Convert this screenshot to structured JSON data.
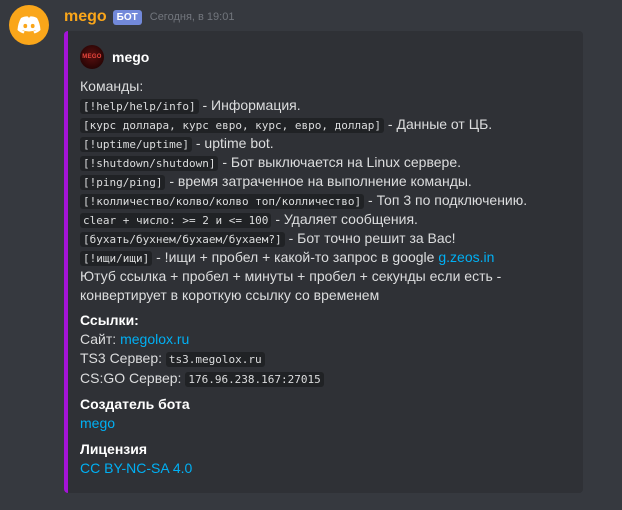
{
  "message": {
    "author": "mego",
    "bot_tag": "БОТ",
    "timestamp": "Сегодня, в 19:01",
    "avatar_icon": "discord-logo-icon",
    "avatar_color": "#faa61a"
  },
  "embed": {
    "accent_color": "#a513d8",
    "author_name": "mego",
    "author_icon_text": "MEGO",
    "description": {
      "heading": "Команды:",
      "commands": [
        {
          "code": "[!help/help/info]",
          "text": " - Информация."
        },
        {
          "code": "[курс доллара, курс евро, курс, евро, доллар]",
          "text": " - Данные от ЦБ."
        },
        {
          "code": "[!uptime/uptime]",
          "text": " - uptime bot."
        },
        {
          "code": "[!shutdown/shutdown]",
          "text": " - Бот выключается на Linux сервере."
        },
        {
          "code": "[!ping/ping]",
          "text": " - время затраченное на выполнение команды."
        },
        {
          "code": "[!колличество/колво/колво топ/колличество]",
          "text": " - Топ 3 по подключению."
        },
        {
          "code": "clear + число: >= 2 и <= 100",
          "text": " - Удаляет сообщения."
        },
        {
          "code": "[бухать/бухнем/бухаем/бухаем?]",
          "text": " - Бот точно решит за Вас!"
        }
      ],
      "search_command": {
        "code": "[!ищи/ищи]",
        "text": " - !ищи + пробел + какой-то запрос в google ",
        "link": "g.zeos.in"
      },
      "youtube_text": "Ютуб ссылка + пробел + минуты + пробел + секунды если есть - конвертирует в короткую ссылку со временем"
    },
    "fields": {
      "links": {
        "name": "Ссылки:",
        "site_label": "Сайт: ",
        "site_link": "megolox.ru",
        "ts3_label": "TS3 Сервер: ",
        "ts3_value": "ts3.megolox.ru",
        "csgo_label": "CS:GO Сервер: ",
        "csgo_value": "176.96.238.167:27015"
      },
      "creator": {
        "name": "Создатель бота",
        "value": "mego"
      },
      "license": {
        "name": "Лицензия",
        "value": "CC BY-NC-SA 4.0"
      }
    }
  }
}
